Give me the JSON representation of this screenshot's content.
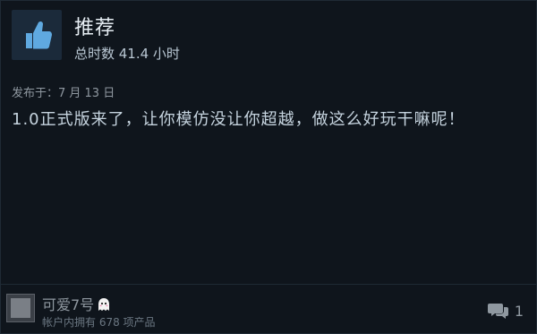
{
  "review_header": {
    "title": "推荐",
    "hours": "总时数 41.4 小时",
    "thumb_icon": "thumbs-up-icon"
  },
  "posted": "发布于：7 月 13 日",
  "review_text": "1.0正式版来了，让你模仿没让你超越，做这么好玩干嘛呢！",
  "author": {
    "name": "可爱7号",
    "badge_icon": "ghost-icon",
    "products": "帐户内拥有 678 项产品"
  },
  "comments": {
    "count": "1",
    "icon": "comment-bubble-icon"
  },
  "colors": {
    "background": "#0f151c",
    "thumb_tile": "#1b2a3a",
    "thumb": "#5fa9e0"
  }
}
